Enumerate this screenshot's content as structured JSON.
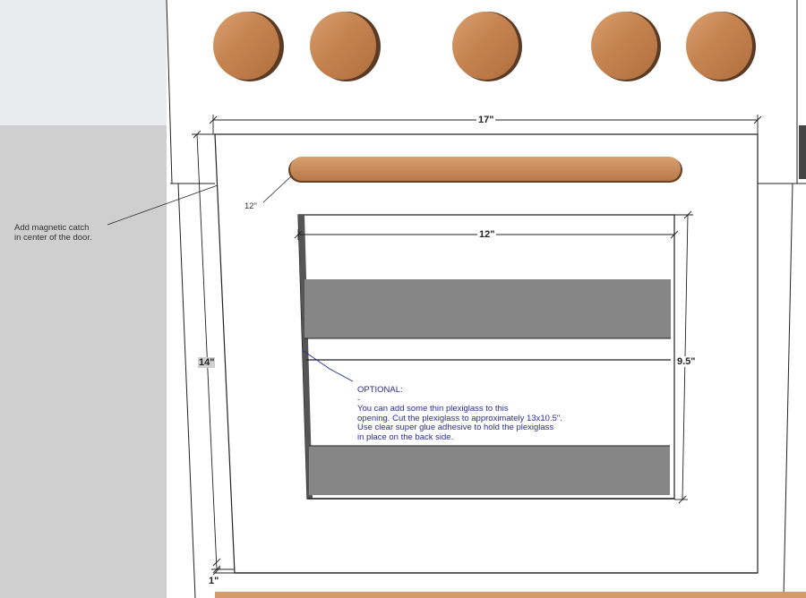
{
  "colors": {
    "wall": "#cfcfcf",
    "wall_light": "#e9ecef",
    "panel": "#ffffff",
    "line": "#222222",
    "rack": "#868686",
    "wood": "#c98a5a",
    "wood_dark": "#7a4a2a",
    "note_blue": "#2a2a9a",
    "floor_wood": "#d59a6a"
  },
  "knobs": {
    "count": 5
  },
  "dimensions": {
    "door_width": "17\"",
    "handle_length": "12\"",
    "window_width": "12\"",
    "door_height": "14\"",
    "window_height": "9.5\"",
    "bottom_gap": "1\""
  },
  "notes": {
    "magnetic_catch": {
      "line1": "Add magnetic catch",
      "line2": "in center of the door."
    },
    "optional": {
      "title": "OPTIONAL:",
      "dash": "-",
      "line1": "You can add some thin plexiglass to this",
      "line2": "opening. Cut the plexiglass to approximately 13x10.5\".",
      "line3": "Use clear super glue adhesive to hold the plexiglass",
      "line4": "in place on the back side."
    }
  }
}
